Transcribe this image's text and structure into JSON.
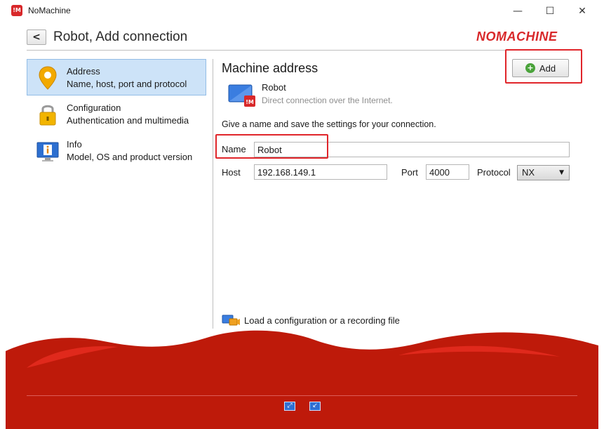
{
  "window": {
    "title": "NoMachine",
    "app_icon_text": "!M",
    "minimize": "—",
    "maximize": "☐",
    "close": "✕"
  },
  "header": {
    "back_label": "<",
    "title": "Robot, Add connection",
    "brand": "NOMACHINE"
  },
  "sidebar": {
    "items": [
      {
        "title": "Address",
        "subtitle": "Name, host, port and protocol",
        "selected": true,
        "icon": "location-pin-icon"
      },
      {
        "title": "Configuration",
        "subtitle": "Authentication and multimedia",
        "selected": false,
        "icon": "lock-icon"
      },
      {
        "title": "Info",
        "subtitle": "Model, OS and product version",
        "selected": false,
        "icon": "info-monitor-icon"
      }
    ]
  },
  "main": {
    "section_title": "Machine address",
    "add_label": "Add",
    "connection": {
      "name": "Robot",
      "description": "Direct connection over the Internet."
    },
    "instructions": "Give a name and save the settings for your connection.",
    "fields": {
      "name_label": "Name",
      "name_value": "Robot",
      "host_label": "Host",
      "host_value": "192.168.149.1",
      "port_label": "Port",
      "port_value": "4000",
      "protocol_label": "Protocol",
      "protocol_value": "NX"
    },
    "load_link": "Load a configuration or a recording file"
  },
  "colors": {
    "brand_red": "#d8282a",
    "footer_red": "#be1a0a",
    "highlight": "#e0252a",
    "selection": "#cde3f8"
  }
}
